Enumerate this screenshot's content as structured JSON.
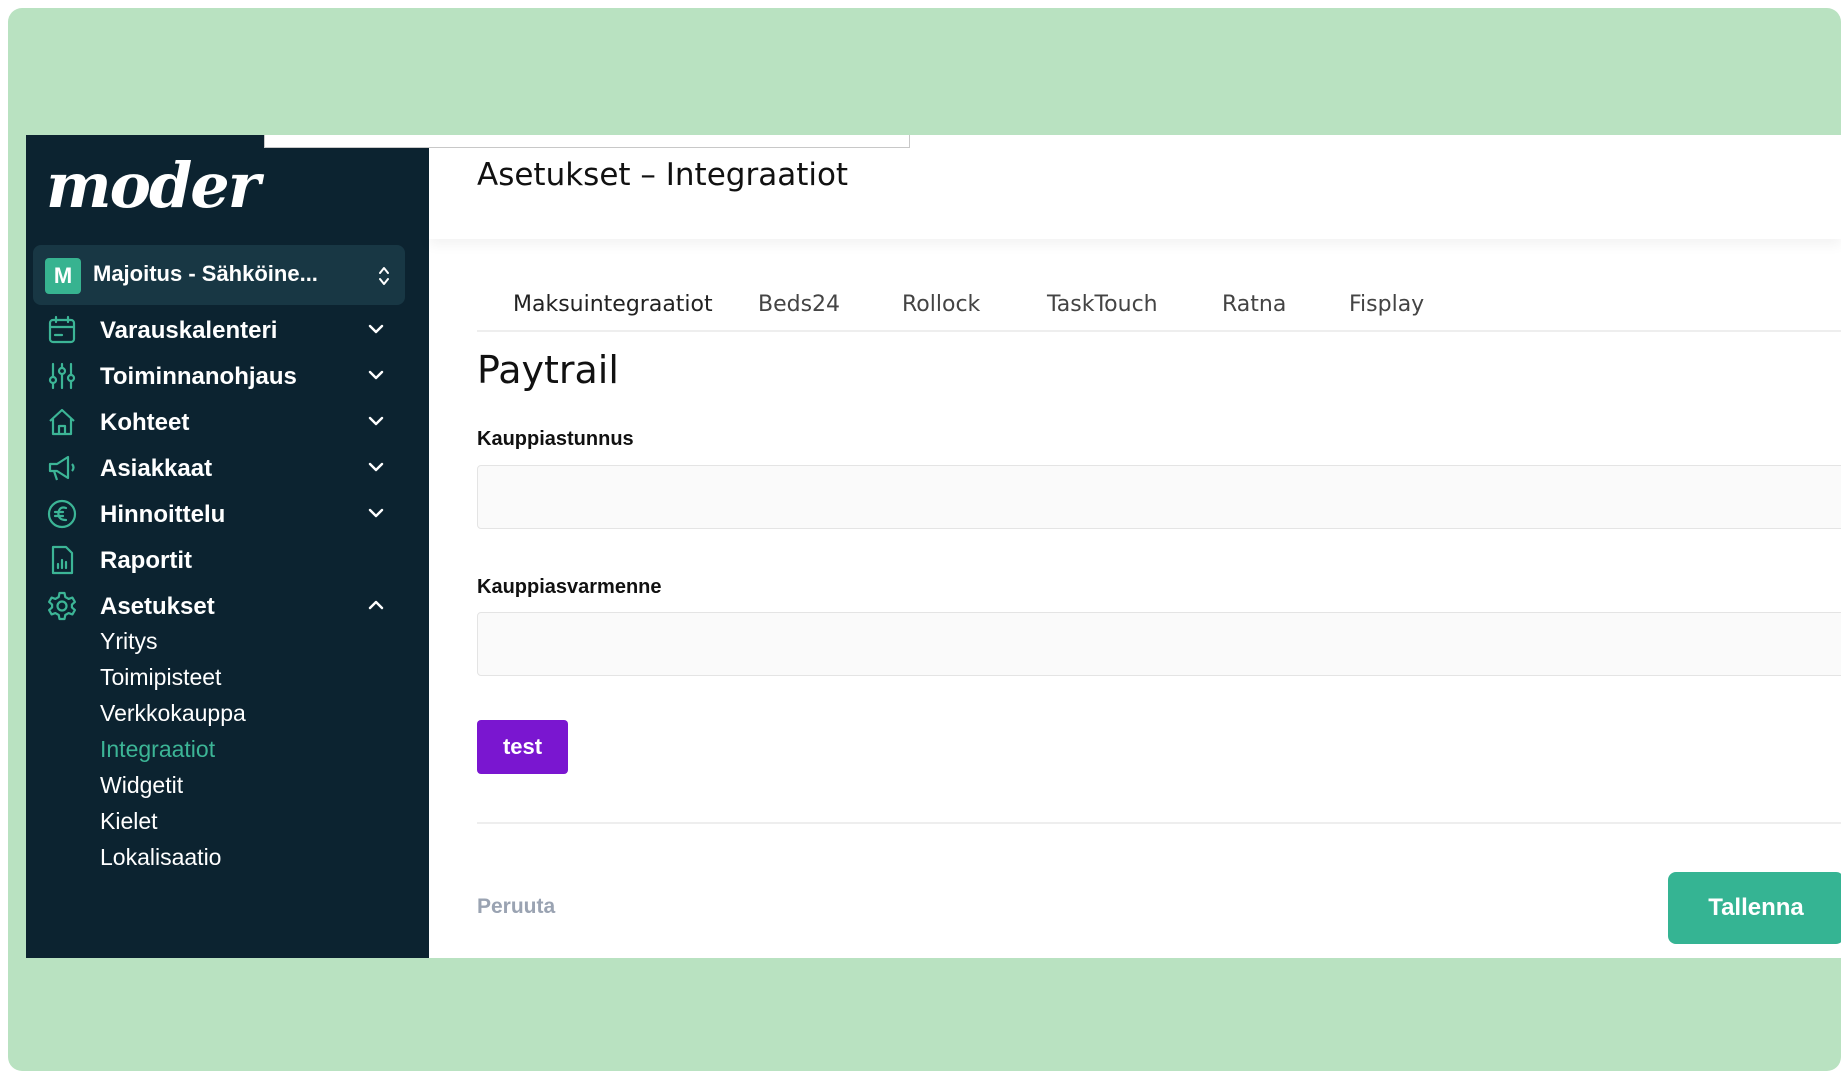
{
  "app": {
    "logo_text": "moder",
    "accent_color": "#3cb596",
    "sidebar_bg": "#0c2330"
  },
  "org_switcher": {
    "avatar_letter": "M",
    "name": "Majoitus - Sähköine..."
  },
  "sidebar": {
    "items": [
      {
        "label": "Varauskalenteri",
        "icon": "calendar-icon",
        "expanded": false
      },
      {
        "label": "Toiminnanohjaus",
        "icon": "sliders-icon",
        "expanded": false
      },
      {
        "label": "Kohteet",
        "icon": "home-icon",
        "expanded": false
      },
      {
        "label": "Asiakkaat",
        "icon": "megaphone-icon",
        "expanded": false
      },
      {
        "label": "Hinnoittelu",
        "icon": "euro-icon",
        "expanded": false
      },
      {
        "label": "Raportit",
        "icon": "report-icon"
      },
      {
        "label": "Asetukset",
        "icon": "gear-icon",
        "expanded": true
      }
    ],
    "sub_items": [
      {
        "label": "Yritys"
      },
      {
        "label": "Toimipisteet"
      },
      {
        "label": "Verkkokauppa"
      },
      {
        "label": "Integraatiot",
        "active": true
      },
      {
        "label": "Widgetit"
      },
      {
        "label": "Kielet"
      },
      {
        "label": "Lokalisaatio"
      }
    ]
  },
  "header": {
    "title": "Asetukset – Integraatiot"
  },
  "tabs": [
    {
      "label": "Maksuintegraatiot",
      "active": true
    },
    {
      "label": "Beds24"
    },
    {
      "label": "Rollock"
    },
    {
      "label": "TaskTouch"
    },
    {
      "label": "Ratna"
    },
    {
      "label": "Fisplay"
    }
  ],
  "form": {
    "section_title": "Paytrail",
    "merchant_id_label": "Kauppiastunnus",
    "merchant_id_value": "",
    "merchant_secret_label": "Kauppiasvarmenne",
    "merchant_secret_value": "",
    "test_button": "test",
    "test_button_color": "#7a16d0"
  },
  "footer": {
    "cancel_label": "Peruuta",
    "save_label": "Tallenna",
    "save_color": "#35b493"
  }
}
